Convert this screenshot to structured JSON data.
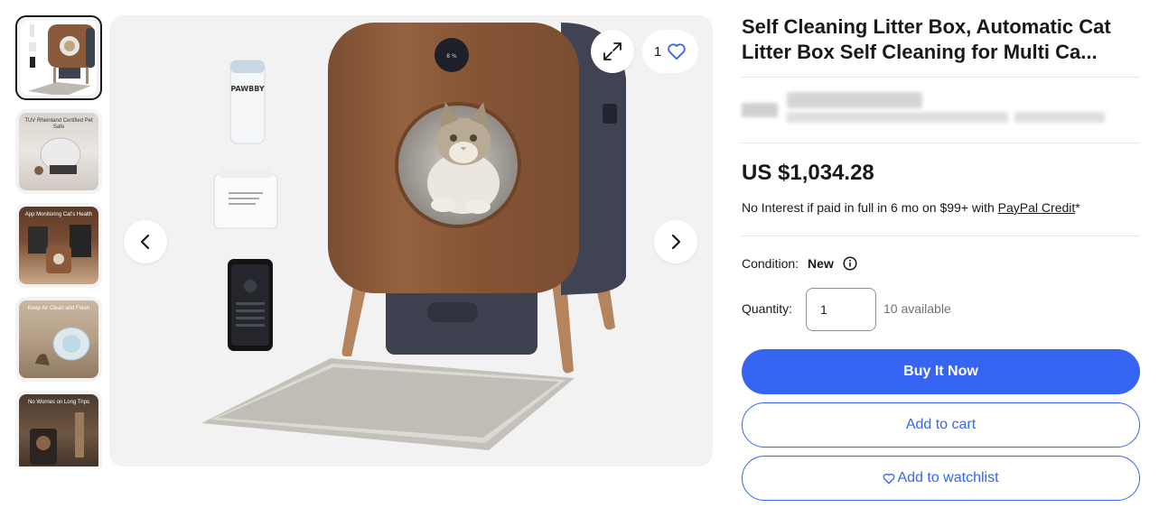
{
  "gallery": {
    "thumbnails": [
      {
        "caption": ""
      },
      {
        "caption": "TUV Rheinland Certified Pet Safe"
      },
      {
        "caption": "App Monitoring Cat's Health"
      },
      {
        "caption": "Keep Air Clean and Fresh"
      },
      {
        "caption": "No Worries on Long Trips"
      }
    ],
    "main_image": {
      "brand_text": "PAWBBY",
      "display_text": "8 %"
    },
    "watch_count": "1",
    "icons": {
      "prev": "chevron-left-icon",
      "next": "chevron-right-icon",
      "expand": "expand-icon",
      "watch": "heart-icon"
    }
  },
  "listing": {
    "title": "Self Cleaning Litter Box, Automatic Cat Litter Box Self Cleaning for Multi Ca...",
    "price": "US $1,034.28",
    "finance": {
      "text": "No Interest if paid in full in 6 mo on $99+ with",
      "link": "PayPal Credit",
      "suffix": "*"
    },
    "condition": {
      "label": "Condition:",
      "value": "New"
    },
    "quantity": {
      "label": "Quantity:",
      "value": "1",
      "available": "10 available"
    },
    "buttons": {
      "buy_now": "Buy It Now",
      "add_to_cart": "Add to cart",
      "add_to_watchlist": "Add to watchlist"
    }
  },
  "colors": {
    "accent": "#3665f3",
    "text": "#191919",
    "muted": "#707070",
    "divider": "#e5e5e5"
  }
}
